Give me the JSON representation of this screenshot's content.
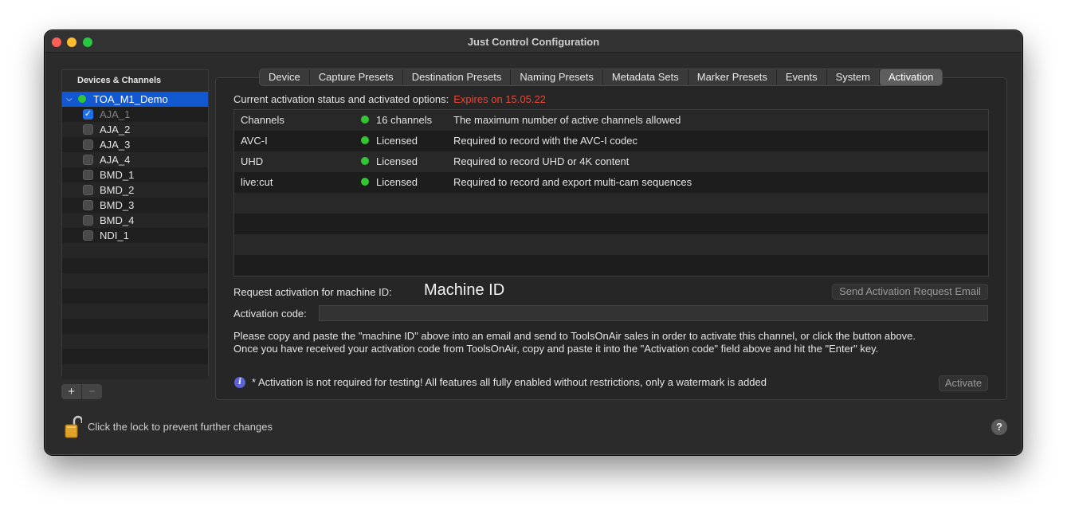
{
  "window": {
    "title": "Just Control Configuration"
  },
  "sidebar": {
    "header": "Devices & Channels",
    "root": {
      "label": "TOA_M1_Demo",
      "status_color": "#33c634"
    },
    "channels": [
      {
        "label": "AJA_1",
        "checked": true
      },
      {
        "label": "AJA_2",
        "checked": false
      },
      {
        "label": "AJA_3",
        "checked": false
      },
      {
        "label": "AJA_4",
        "checked": false
      },
      {
        "label": "BMD_1",
        "checked": false
      },
      {
        "label": "BMD_2",
        "checked": false
      },
      {
        "label": "BMD_3",
        "checked": false
      },
      {
        "label": "BMD_4",
        "checked": false
      },
      {
        "label": "NDI_1",
        "checked": false
      }
    ],
    "add_label": "+",
    "remove_label": "−"
  },
  "tabs": [
    {
      "label": "Device",
      "active": false
    },
    {
      "label": "Capture Presets",
      "active": false
    },
    {
      "label": "Destination Presets",
      "active": false
    },
    {
      "label": "Naming Presets",
      "active": false
    },
    {
      "label": "Metadata Sets",
      "active": false
    },
    {
      "label": "Marker Presets",
      "active": false
    },
    {
      "label": "Events",
      "active": false
    },
    {
      "label": "System",
      "active": false
    },
    {
      "label": "Activation",
      "active": true
    }
  ],
  "activation": {
    "status_label": "Current activation status and activated options:",
    "expires": "Expires on 15.05.22",
    "options": [
      {
        "name": "Channels",
        "value": "16 channels",
        "description": "The maximum number of active channels allowed"
      },
      {
        "name": "AVC-I",
        "value": "Licensed",
        "description": "Required to record with the AVC-I codec"
      },
      {
        "name": "UHD",
        "value": "Licensed",
        "description": "Required to record UHD or 4K content"
      },
      {
        "name": "live:cut",
        "value": "Licensed",
        "description": "Required to record and export multi-cam sequences"
      }
    ],
    "request_label": "Request activation for machine ID:",
    "machine_id": "Machine ID",
    "send_button": "Send Activation Request Email",
    "code_label": "Activation code:",
    "code_value": "",
    "help_line1": "Please copy and paste the \"machine ID\" above into an email and send to ToolsOnAir sales in order to activate this channel, or click the button above.",
    "help_line2": "Once you have received your activation code from ToolsOnAir, copy and paste it into the \"Activation code\" field above and hit the \"Enter\" key.",
    "info_icon": "i",
    "note": "* Activation is not required for testing! All features all fully enabled without restrictions, only a watermark is added",
    "activate_button": "Activate"
  },
  "footer": {
    "lock_text": "Click the lock to prevent further changes",
    "help_label": "?"
  },
  "colors": {
    "status_green": "#33c634",
    "expires_red": "#e5493a",
    "selection_blue": "#1259d1"
  }
}
